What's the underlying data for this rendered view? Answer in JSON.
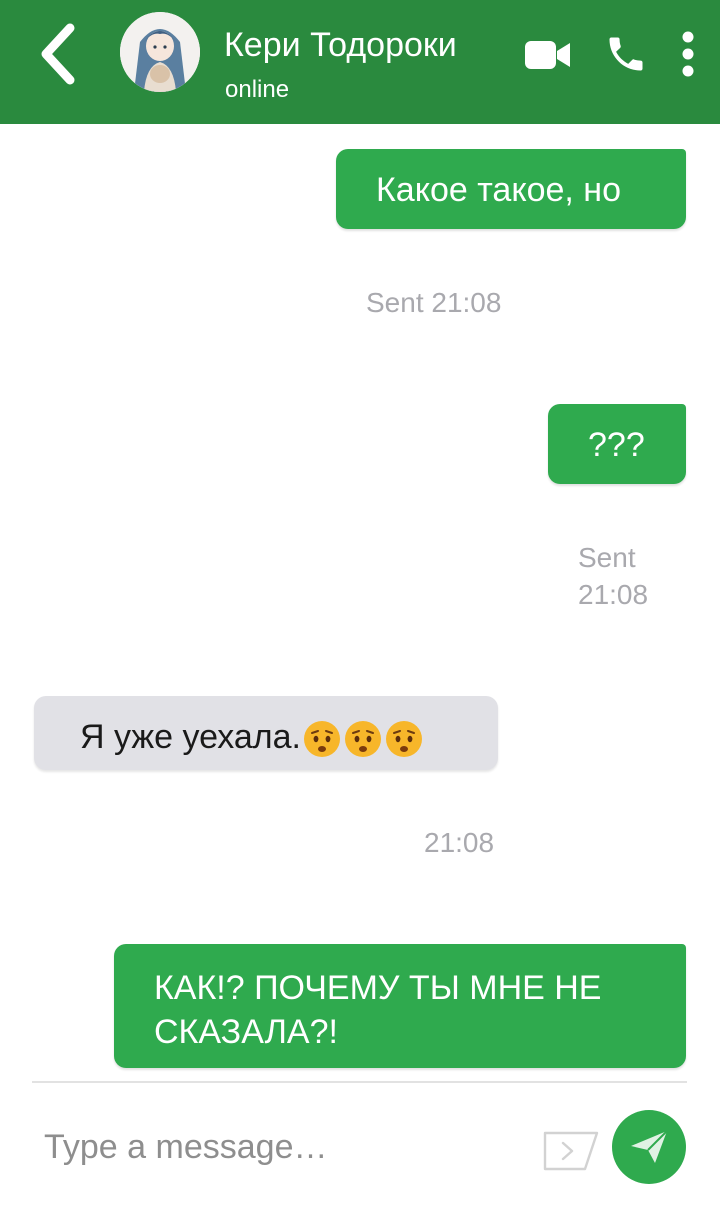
{
  "header": {
    "contact_name": "Кери Тодороки",
    "contact_status": "online",
    "icons": [
      "back-arrow-icon",
      "avatar",
      "video-camera-icon",
      "phone-icon",
      "more-vertical-icon"
    ]
  },
  "messages": [
    {
      "direction": "outgoing",
      "text": "Какое такое, но",
      "meta": "Sent 21:08"
    },
    {
      "direction": "outgoing",
      "text": "???",
      "meta_line1": "Sent",
      "meta_line2": "21:08"
    },
    {
      "direction": "incoming",
      "text": "Я уже уехала.",
      "emoji": "hushed-face x3",
      "meta": "21:08"
    },
    {
      "direction": "outgoing",
      "text": "КАК!? ПОЧЕМУ ТЫ МНЕ НЕ СКАЗАЛА?!"
    }
  ],
  "composer": {
    "placeholder": "Type a message…",
    "icons": [
      "sticker-icon",
      "send-icon"
    ]
  },
  "colors": {
    "header": "#2a8a3e",
    "outgoing_bubble": "#2faa4e",
    "incoming_bubble": "#e1e1e6",
    "meta_text": "#a9a9ae"
  }
}
